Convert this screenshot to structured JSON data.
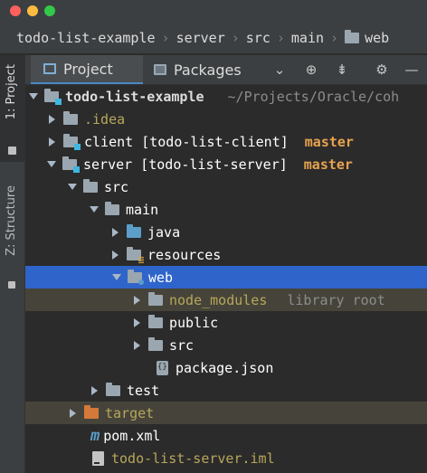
{
  "window": {
    "traffic_lights": {
      "close": "#fc615d",
      "minimize": "#fdbc40",
      "zoom": "#34c84a"
    }
  },
  "breadcrumb": [
    "todo-list-example",
    "server",
    "src",
    "main",
    "web"
  ],
  "toolstrip": {
    "project_label": "1: Project",
    "structure_label": "Z: Structure"
  },
  "tool_window": {
    "tabs": [
      {
        "label": "Project"
      },
      {
        "label": "Packages"
      }
    ],
    "actions": [
      "dropdown-icon",
      "locate-icon",
      "collapse-all-icon",
      "gear-icon",
      "minimize-icon"
    ]
  },
  "tree": [
    {
      "label": "todo-list-example",
      "path": "~/Projects/Oracle/coh",
      "expanded": true
    },
    {
      "label": ".idea"
    },
    {
      "label": "client [todo-list-client]",
      "branch": "master"
    },
    {
      "label": "server [todo-list-server]",
      "branch": "master",
      "expanded": true
    },
    {
      "label": "src",
      "expanded": true
    },
    {
      "label": "main",
      "expanded": true
    },
    {
      "label": "java"
    },
    {
      "label": "resources"
    },
    {
      "label": "web",
      "expanded": true,
      "selected": true
    },
    {
      "label": "node_modules",
      "hint": "library root"
    },
    {
      "label": "public"
    },
    {
      "label": "src"
    },
    {
      "label": "package.json"
    },
    {
      "label": "test"
    },
    {
      "label": "target"
    },
    {
      "label": "pom.xml"
    },
    {
      "label": "todo-list-server.iml"
    }
  ],
  "colors": {
    "selection": "#2f65ca",
    "excluded_background": "#46443a",
    "branch": "#e8a34e",
    "background": "#2b2b2b"
  }
}
